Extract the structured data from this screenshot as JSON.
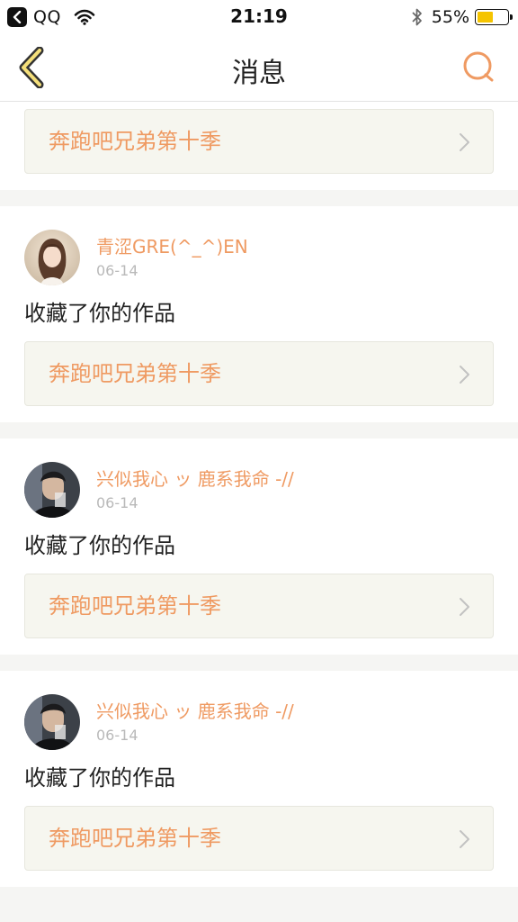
{
  "status_bar": {
    "back_app": "QQ",
    "time": "21:19",
    "battery": "55%",
    "battery_level": 0.55,
    "battery_color": "#f5c400"
  },
  "nav": {
    "title": "消息",
    "back_icon": "chevron-left-icon",
    "search_icon": "search-icon",
    "accent": "#ef9a62"
  },
  "top_item": {
    "work_title": "奔跑吧兄弟第十季"
  },
  "notifications": [
    {
      "username": "青涩GRE(^_^)EN",
      "date": "06-14",
      "action": "收藏了你的作品",
      "work_title": "奔跑吧兄弟第十季"
    },
    {
      "username": "兴似我心 ッ 鹿系我命 -//",
      "date": "06-14",
      "action": "收藏了你的作品",
      "work_title": "奔跑吧兄弟第十季"
    },
    {
      "username": "兴似我心 ッ 鹿系我命 -//",
      "date": "06-14",
      "action": "收藏了你的作品",
      "work_title": "奔跑吧兄弟第十季"
    }
  ]
}
